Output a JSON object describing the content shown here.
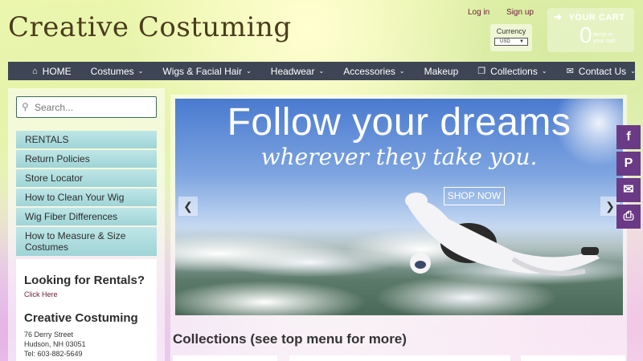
{
  "header": {
    "site_title": "Creative Costuming",
    "links": {
      "login": "Log in",
      "signup": "Sign up"
    },
    "currency": {
      "label": "Currency",
      "selected": "USD"
    },
    "cart": {
      "title": "YOUR CART",
      "count": "0",
      "subtitle_line1": "items in",
      "subtitle_line2": "your cart"
    }
  },
  "nav": {
    "items": [
      {
        "label": "HOME",
        "icon": "home-icon",
        "dropdown": false
      },
      {
        "label": "Costumes",
        "dropdown": true
      },
      {
        "label": "Wigs & Facial Hair",
        "dropdown": true
      },
      {
        "label": "Headwear",
        "dropdown": true
      },
      {
        "label": "Accessories",
        "dropdown": true
      },
      {
        "label": "Makeup",
        "dropdown": false
      },
      {
        "label": "Collections",
        "icon": "collections-icon",
        "dropdown": true
      },
      {
        "label": "Contact Us",
        "icon": "envelope-icon",
        "dropdown": true
      }
    ]
  },
  "sidebar": {
    "search_placeholder": "Search...",
    "menu": [
      "RENTALS",
      "Return Policies",
      "Store Locator",
      "How to Clean Your Wig",
      "Wig Fiber Differences",
      "How to Measure & Size Costumes"
    ],
    "info": {
      "rentals_heading": "Looking for Rentals?",
      "rentals_link": "Click Here",
      "store_heading": "Creative Costuming",
      "address_line1": "76 Derry Street",
      "address_line2": "Hudson, NH 03051",
      "address_line3": "Tel: 603-882-5649"
    }
  },
  "banner": {
    "headline": "Follow your dreams",
    "tagline": "wherever they take you.",
    "cta": "SHOP NOW"
  },
  "main": {
    "collections_heading": "Collections (see top menu for more)"
  },
  "social": [
    "facebook-icon",
    "pinterest-icon",
    "email-icon",
    "print-icon"
  ],
  "colors": {
    "nav_bg": "#3e4555",
    "menu_teal": "#9fd4d6",
    "social_purple": "#6b3a86",
    "title_brown": "#4a3c1c"
  }
}
